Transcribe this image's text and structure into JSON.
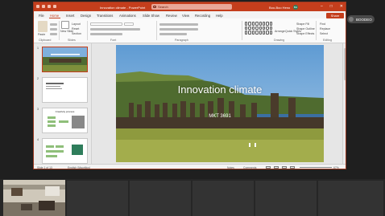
{
  "app": {
    "title": "Innovation climate - PowerPoint",
    "search_placeholder": "Search",
    "user": "Boo-Boo Heno",
    "user_initials": "BH"
  },
  "window_controls": [
    "–",
    "□",
    "✕"
  ],
  "ribbon": {
    "tabs": [
      "File",
      "Home",
      "Insert",
      "Design",
      "Transitions",
      "Animations",
      "Slide Show",
      "Review",
      "View",
      "Recording",
      "Help"
    ],
    "active_tab": "Home",
    "share_label": "Share",
    "groups": {
      "clipboard": "Clipboard",
      "slides": "Slides",
      "font": "Font",
      "paragraph": "Paragraph",
      "drawing": "Drawing",
      "editing": "Editing"
    },
    "buttons": {
      "paste": "Paste",
      "new_slide": "New Slide",
      "layout": "Layout",
      "reset": "Reset",
      "section": "Section",
      "arrange": "Arrange",
      "quick_styles": "Quick Styles",
      "shape_fill": "Shape Fill",
      "shape_outline": "Shape Outline",
      "shape_effects": "Shape Effects",
      "find": "Find",
      "replace": "Replace",
      "select": "Select"
    }
  },
  "thumbnails": [
    {
      "num": "1",
      "kind": "photo"
    },
    {
      "num": "2",
      "kind": "text"
    },
    {
      "num": "3",
      "kind": "diagram",
      "title": "Creativity process"
    },
    {
      "num": "4",
      "kind": "diagram2"
    }
  ],
  "slide": {
    "title": "Innovation climate",
    "subtitle": "MKT 3691"
  },
  "status": {
    "slide_info": "Slide 1 of 13",
    "language": "English (Mauritius)",
    "notes": "Notes",
    "comments": "Comments",
    "zoom": "67%"
  },
  "overlay": {
    "label": "BOODEO"
  },
  "colors": {
    "accent": "#c43e1c",
    "taskbar": "#262626"
  }
}
